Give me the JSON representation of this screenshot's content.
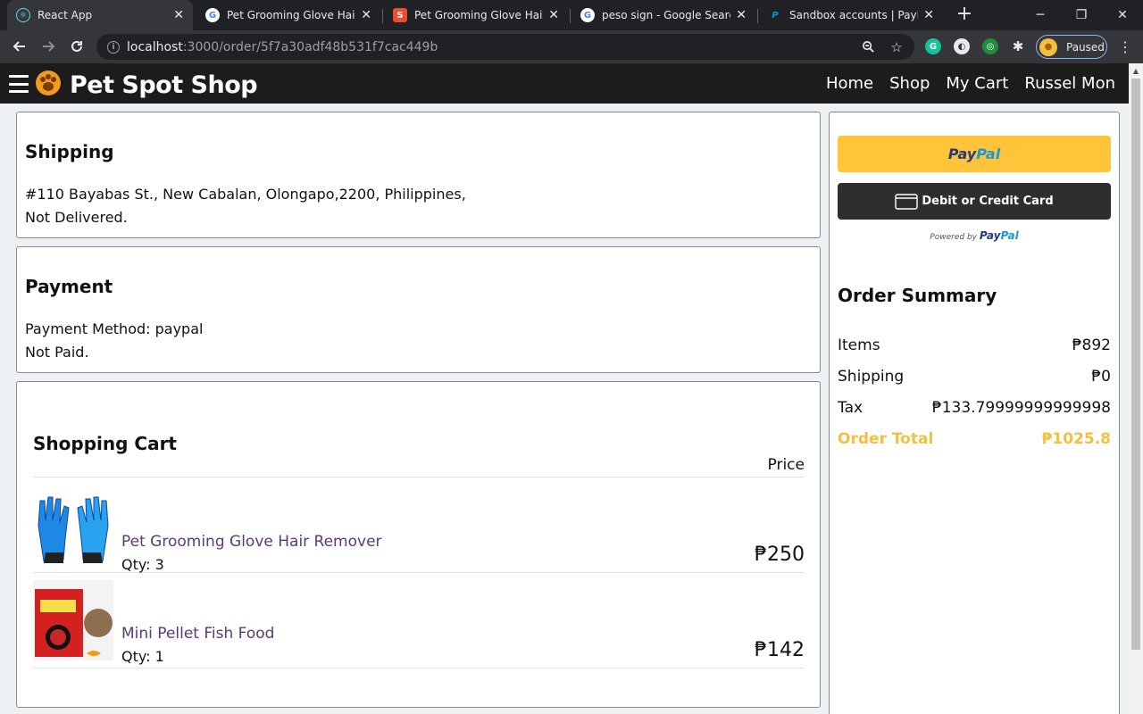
{
  "browser": {
    "tabs": [
      {
        "title": "React App",
        "active": true
      },
      {
        "title": "Pet Grooming Glove Hair Re",
        "active": false
      },
      {
        "title": "Pet Grooming Glove Hair Re",
        "active": false
      },
      {
        "title": "peso sign - Google Search",
        "active": false
      },
      {
        "title": "Sandbox accounts | PayPal D",
        "active": false
      }
    ],
    "url_host": "localhost",
    "url_path": ":3000/order/5f7a30adf48b531f7cac449b",
    "profile_label": "Paused",
    "icons": {
      "back": "arrow-left-icon",
      "forward": "arrow-right-icon",
      "reload": "reload-icon",
      "zoom": "zoom-icon",
      "star": "star-icon",
      "extensions": "puzzle-icon",
      "menu": "more-vert-icon"
    }
  },
  "header": {
    "brand": "Pet Spot Shop",
    "nav": [
      "Home",
      "Shop",
      "My Cart",
      "Russel Mon"
    ]
  },
  "shipping": {
    "title": "Shipping",
    "address": "#110 Bayabas St., New Cabalan, Olongapo,2200, Philippines,",
    "status": "Not Delivered."
  },
  "payment": {
    "title": "Payment",
    "method": "Payment Method: paypal",
    "status": "Not Paid."
  },
  "cart": {
    "title": "Shopping Cart",
    "price_header": "Price",
    "items": [
      {
        "name": "Pet Grooming Glove Hair Remover",
        "qty": "Qty: 3",
        "price": "₱250"
      },
      {
        "name": "Mini Pellet Fish Food",
        "qty": "Qty: 1",
        "price": "₱142"
      }
    ]
  },
  "paypal": {
    "button_label": "PayPal",
    "card_label": "Debit or Credit Card",
    "powered_prefix": "Powered by",
    "powered_brand": "PayPal"
  },
  "summary": {
    "title": "Order Summary",
    "rows": [
      {
        "label": "Items",
        "value": "₱892"
      },
      {
        "label": "Shipping",
        "value": "₱0"
      },
      {
        "label": "Tax",
        "value": "₱133.79999999999998"
      }
    ],
    "total_label": "Order Total",
    "total_value": "₱1025.8"
  },
  "colors": {
    "accent": "#f0c040",
    "header_bg": "#1c1c1c",
    "paypal_yellow": "#ffc439",
    "card_button": "#2c2e2f",
    "link": "#5a3a7a"
  }
}
